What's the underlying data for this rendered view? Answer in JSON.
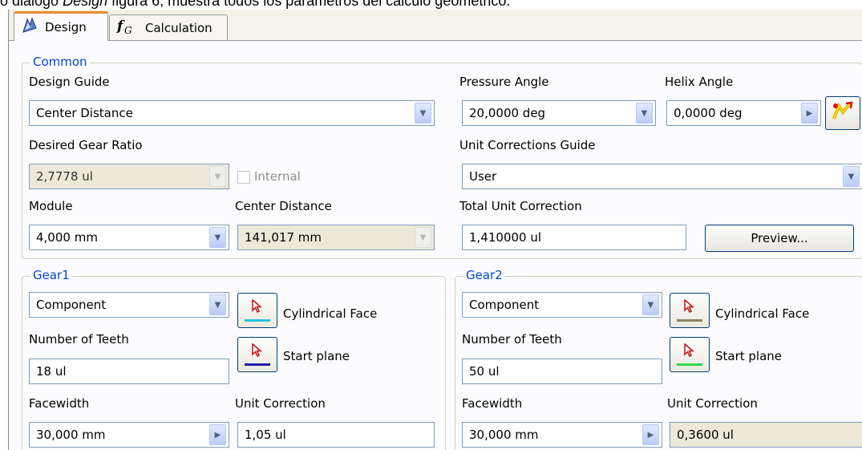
{
  "caption": {
    "prefix": "o diálogo ",
    "italic": "Design",
    "suffix": " figura 6, muestra todos los parámetros del cálculo geométrico."
  },
  "tabs": [
    {
      "label": "Design"
    },
    {
      "label": "Calculation"
    }
  ],
  "common": {
    "title": "Common",
    "design_guide": {
      "label": "Design Guide",
      "value": "Center Distance"
    },
    "pressure_angle": {
      "label": "Pressure Angle",
      "value": "20,0000 deg"
    },
    "helix_angle": {
      "label": "Helix Angle",
      "value": "0,0000 deg"
    },
    "desired_gear_ratio": {
      "label": "Desired Gear Ratio",
      "value": "2,7778 ul"
    },
    "internal": {
      "label": "Internal"
    },
    "unit_corrections_guide": {
      "label": "Unit Corrections Guide",
      "value": "User"
    },
    "module": {
      "label": "Module",
      "value": "4,000 mm"
    },
    "center_distance": {
      "label": "Center Distance",
      "value": "141,017 mm"
    },
    "total_unit_correction": {
      "label": "Total Unit Correction",
      "value": "1,410000 ul"
    },
    "preview_button": "Preview..."
  },
  "gear1": {
    "title": "Gear1",
    "type": "Component",
    "cylindrical_face": "Cylindrical Face",
    "number_of_teeth": {
      "label": "Number of Teeth",
      "value": "18 ul"
    },
    "start_plane": "Start plane",
    "facewidth": {
      "label": "Facewidth",
      "value": "30,000 mm"
    },
    "unit_correction": {
      "label": "Unit Correction",
      "value": "1,05 ul"
    }
  },
  "gear2": {
    "title": "Gear2",
    "type": "Component",
    "cylindrical_face": "Cylindrical Face",
    "number_of_teeth": {
      "label": "Number of Teeth",
      "value": "50 ul"
    },
    "start_plane": "Start plane",
    "facewidth": {
      "label": "Facewidth",
      "value": "30,000 mm"
    },
    "unit_correction": {
      "label": "Unit Correction",
      "value": "0,3600 ul"
    }
  },
  "colors": {
    "gear1_face_bar": "#22c4d8",
    "gear1_plane_bar": "#1a1aa8",
    "gear2_face_bar": "#8d8660",
    "gear2_plane_bar": "#2fd84a",
    "group_title": "#0046d5",
    "active_tab_accent": "#e68b2c"
  },
  "icons": [
    "design-icon",
    "fx-icon",
    "chevron-down-icon",
    "chevron-right-icon",
    "cursor-pick-icon",
    "flip-direction-icon"
  ]
}
